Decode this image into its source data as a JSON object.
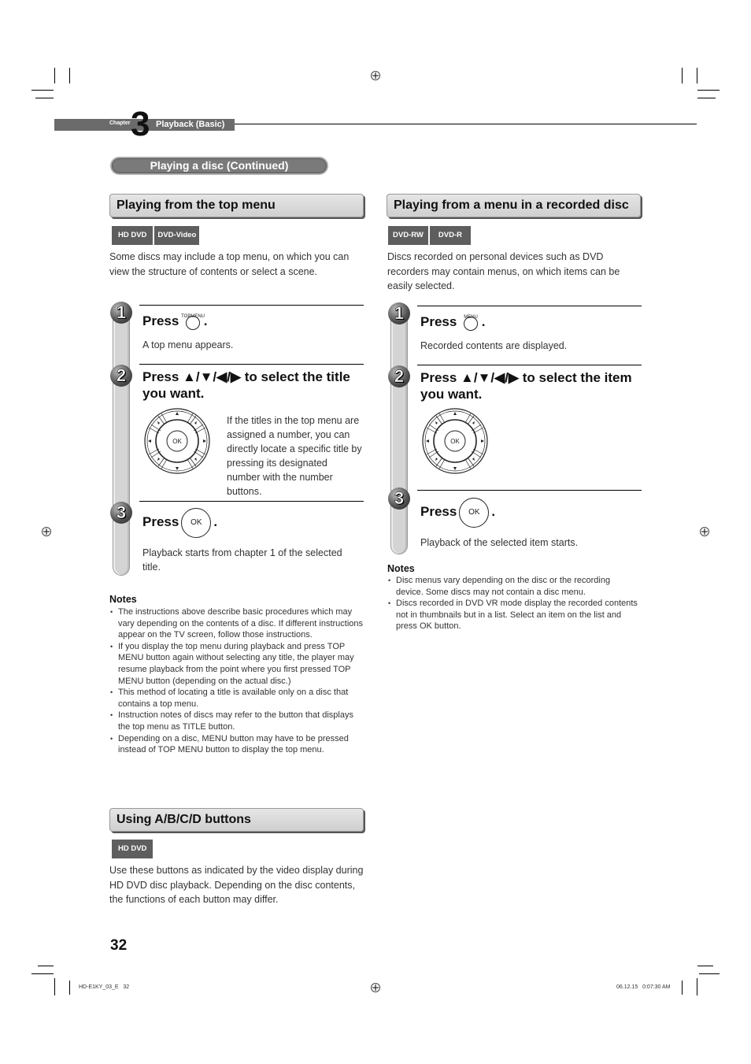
{
  "chapter": {
    "label": "Chapter",
    "number": "3",
    "title": "Playback (Basic)"
  },
  "section_pill": "Playing a disc (Continued)",
  "left": {
    "top_menu": {
      "heading": "Playing from the top menu",
      "badges": [
        "HD DVD",
        "DVD-Video"
      ],
      "intro": "Some discs may include a top menu, on which you can view the structure of contents or select a scene.",
      "steps": [
        {
          "number": "1",
          "title_prefix": "Press",
          "button_caption": "TOPMENU",
          "title_suffix": ".",
          "desc": "A top menu appears."
        },
        {
          "number": "2",
          "title": "Press ▲/▼/◀/▶ to select the title you want.",
          "desc": "If the titles in the top menu are assigned a number, you can directly locate a specific title by pressing its designated number with the number buttons."
        },
        {
          "number": "3",
          "title_prefix": "Press",
          "button_caption": "OK",
          "title_suffix": ".",
          "desc": "Playback starts from chapter 1 of the selected title."
        }
      ],
      "notes_title": "Notes",
      "notes": [
        "The instructions above describe basic procedures which may vary depending on the contents of a disc. If different instructions appear on the TV screen, follow those instructions.",
        "If you display the top menu during playback and press TOP MENU button again without selecting any title, the player may resume playback from the point where you first pressed TOP MENU button (depending on the actual disc.)",
        "This method of locating a title is available only on a disc that contains a top menu.",
        "Instruction notes of discs may refer to the button that displays the top menu as TITLE button.",
        "Depending on a disc, MENU button may have to be pressed instead of TOP MENU button to display the top menu."
      ]
    },
    "abcd": {
      "heading": "Using A/B/C/D buttons",
      "badges": [
        "HD DVD"
      ],
      "intro": "Use these buttons as indicated by the video display during HD DVD disc playback. Depending on the disc contents, the functions of each button may differ."
    }
  },
  "right": {
    "recorded": {
      "heading": "Playing from a menu in a recorded disc",
      "badges": [
        "DVD-RW",
        "DVD-R"
      ],
      "intro": "Discs recorded on personal devices such as DVD recorders may contain menus, on which items can be easily selected.",
      "steps": [
        {
          "number": "1",
          "title_prefix": "Press",
          "button_caption": "MENU",
          "title_suffix": ".",
          "desc": "Recorded contents are displayed."
        },
        {
          "number": "2",
          "title": "Press ▲/▼/◀/▶ to select the item you want."
        },
        {
          "number": "3",
          "title_prefix": "Press",
          "button_caption": "OK",
          "title_suffix": ".",
          "desc": "Playback of the selected item starts."
        }
      ],
      "notes_title": "Notes",
      "notes": [
        "Disc menus vary depending on the disc or the recording device. Some discs may not contain a disc menu.",
        "Discs recorded in DVD VR mode display the recorded contents not in thumbnails but in a list. Select an item on the list and press OK button."
      ]
    }
  },
  "dpad": {
    "center_label": "OK"
  },
  "page_number": "32",
  "footer": {
    "file": "HD-E1KY_03_E   32",
    "timestamp": "06.12.15   0:07:30 AM"
  }
}
